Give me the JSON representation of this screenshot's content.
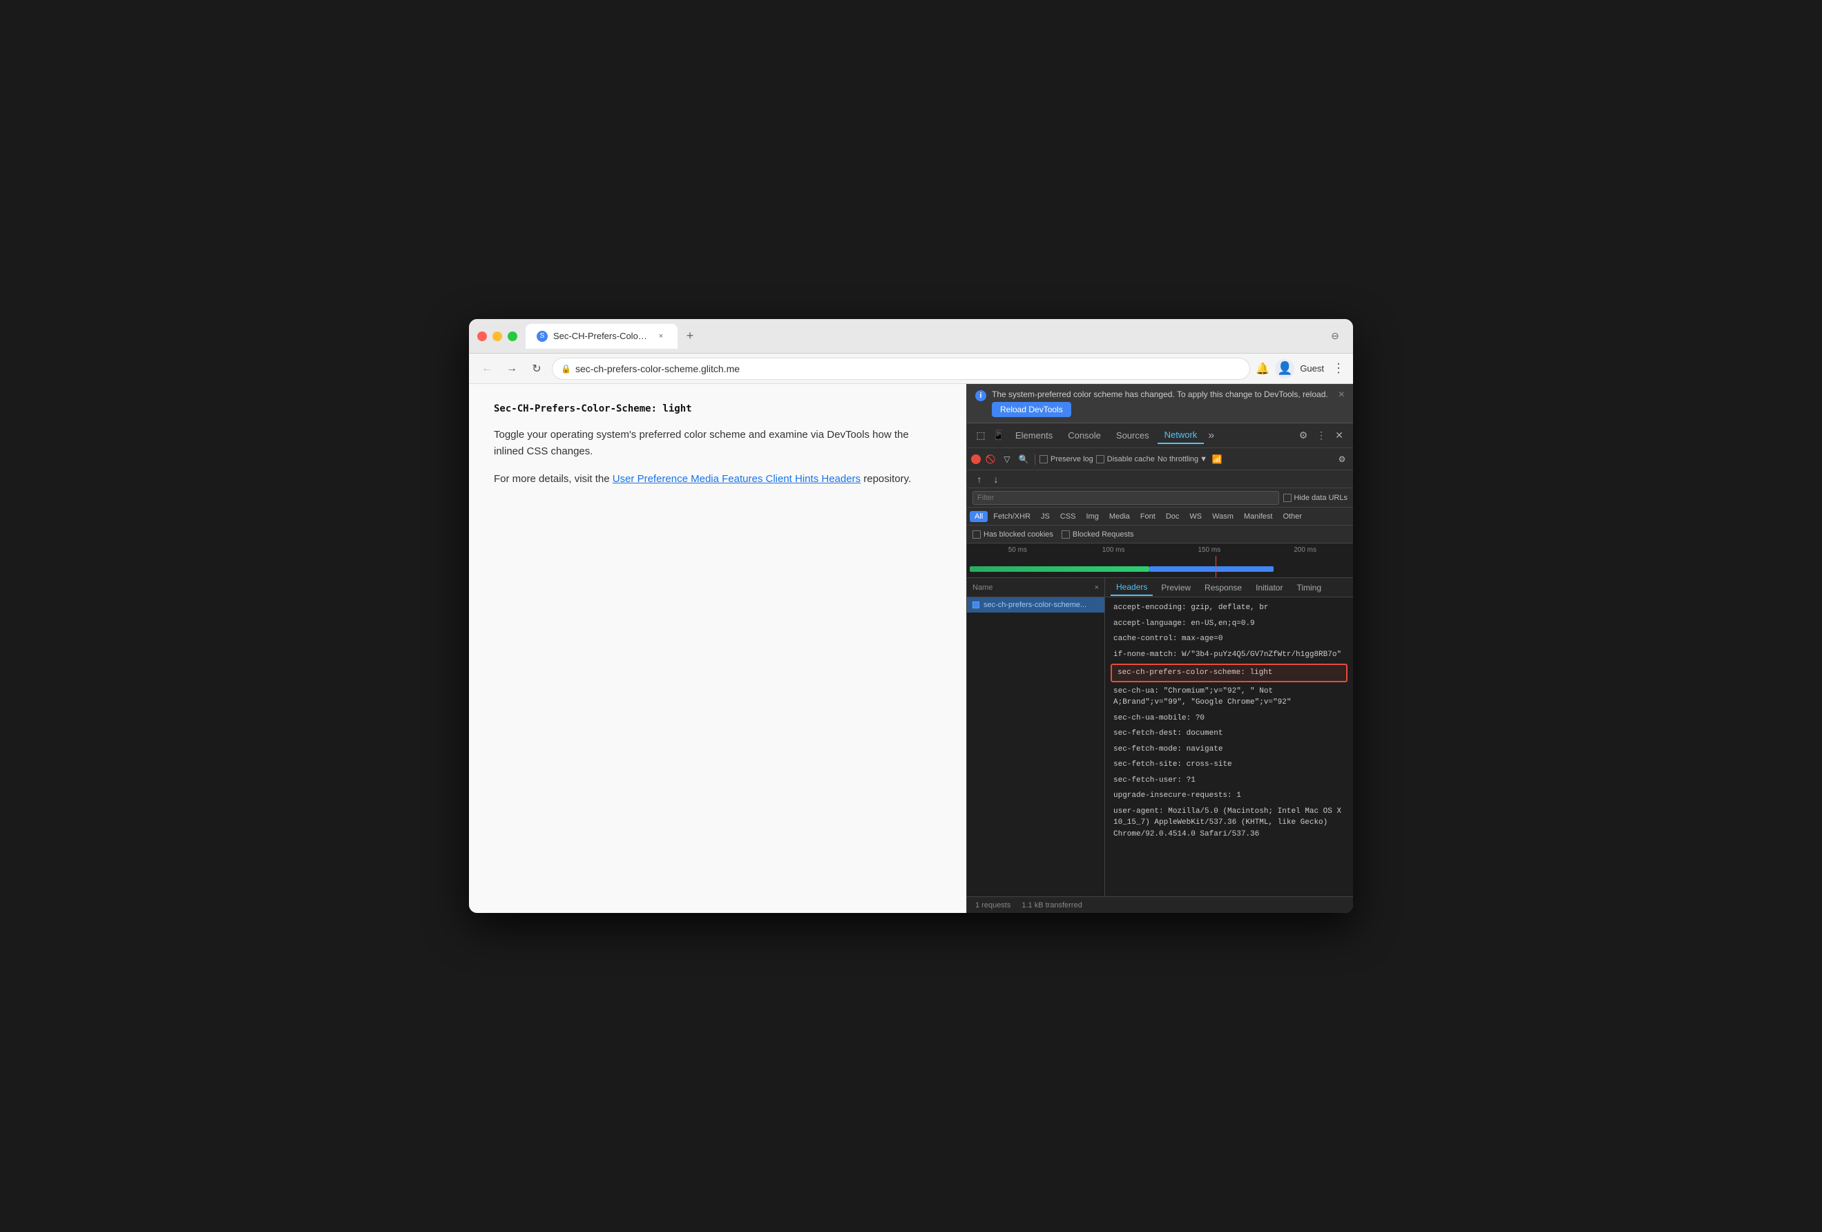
{
  "browser": {
    "tab_title": "Sec-CH-Prefers-Color-Schem...",
    "tab_close": "×",
    "new_tab": "+",
    "url": "sec-ch-prefers-color-scheme.glitch.me",
    "nav_back": "←",
    "nav_forward": "→",
    "nav_reload": "↻",
    "profile_label": "Guest",
    "more_label": "⋮",
    "window_btn": "⊖"
  },
  "webpage": {
    "title": "Sec-CH-Prefers-Color-Scheme: light",
    "paragraph1": "Toggle your operating system's preferred color scheme and examine via DevTools how the inlined CSS changes.",
    "paragraph2_prefix": "For more details, visit the ",
    "link_text": "User Preference Media Features Client Hints Headers",
    "paragraph2_suffix": " repository."
  },
  "devtools": {
    "notification_text": "The system-preferred color scheme has changed. To apply this change to DevTools, reload.",
    "reload_btn": "Reload DevTools",
    "notification_close": "×",
    "tabs": [
      "Elements",
      "Console",
      "Sources",
      "Network"
    ],
    "active_tab": "Network",
    "more_tabs": "»",
    "record_label": "●",
    "clear_label": "🚫",
    "filter_label": "🔍",
    "search_label": "🔍",
    "preserve_log_label": "Preserve log",
    "disable_cache_label": "Disable cache",
    "throttle_label": "No throttling",
    "filter_placeholder": "Filter",
    "hide_data_urls_label": "Hide data URLs",
    "type_filters": [
      "All",
      "Fetch/XHR",
      "JS",
      "CSS",
      "Img",
      "Media",
      "Font",
      "Doc",
      "WS",
      "Wasm",
      "Manifest",
      "Other"
    ],
    "active_type": "All",
    "has_blocked_label": "Has blocked cookies",
    "blocked_requests_label": "Blocked Requests",
    "timeline": {
      "labels": [
        "50 ms",
        "100 ms",
        "150 ms",
        "200 ms"
      ]
    },
    "request_list_header": "Name",
    "request_item": "sec-ch-prefers-color-scheme...",
    "headers_tabs": [
      "Headers",
      "Preview",
      "Response",
      "Initiator",
      "Timing"
    ],
    "active_headers_tab": "Headers",
    "headers": [
      {
        "key": "accept-encoding:",
        "val": " gzip, deflate, br"
      },
      {
        "key": "accept-language:",
        "val": " en-US,en;q=0.9"
      },
      {
        "key": "cache-control:",
        "val": " max-age=0"
      },
      {
        "key": "if-none-match:",
        "val": " W/\"3b4-puYz4Q5/GV7nZfWtr/h1gg8RB7o\""
      },
      {
        "key": "sec-ch-prefers-color-scheme:",
        "val": " light",
        "highlighted": true
      },
      {
        "key": "sec-ch-ua:",
        "val": " \"Chromium\";v=\"92\", \" Not A;Brand\";v=\"99\", \"Google Chrome\";v=\"92\""
      },
      {
        "key": "sec-ch-ua-mobile:",
        "val": " ?0"
      },
      {
        "key": "sec-fetch-dest:",
        "val": " document"
      },
      {
        "key": "sec-fetch-mode:",
        "val": " navigate"
      },
      {
        "key": "sec-fetch-site:",
        "val": " cross-site"
      },
      {
        "key": "sec-fetch-user:",
        "val": " ?1"
      },
      {
        "key": "upgrade-insecure-requests:",
        "val": " 1"
      },
      {
        "key": "user-agent:",
        "val": " Mozilla/5.0 (Macintosh; Intel Mac OS X 10_15_7) AppleWebKit/537.36 (KHTML, like Gecko) Chrome/92.0.4514.0 Safari/537.36"
      }
    ],
    "status_requests": "1 requests",
    "status_transferred": "1.1 kB transferred"
  }
}
